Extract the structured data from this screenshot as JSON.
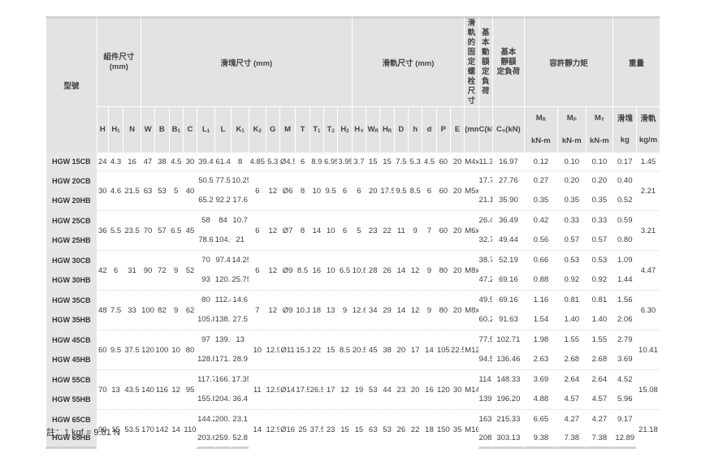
{
  "header": {
    "model": "型號",
    "assembly": "組件尺寸\n(mm)",
    "block": "滑塊尺寸 (mm)",
    "rail": "滑軌尺寸 (mm)",
    "bolt": "滑軌的\n固定螺\n栓尺寸",
    "dyn": "基本\n動額\n定負荷",
    "stat": "基本\n靜額\n定負荷",
    "moment": "容許靜力矩",
    "weight": "重量",
    "block_w": "滑塊",
    "rail_w": "滑軌",
    "bolt_unit": "(mm)",
    "c_unit": "C(kN)",
    "c0_unit": "C₀(kN)",
    "mr_unit": "kN-m",
    "mp_unit": "kN-m",
    "my_unit": "kN-m",
    "kg_unit": "kg",
    "kgm_unit": "kg/m",
    "cols": [
      "H",
      "H₁",
      "N",
      "W",
      "B",
      "B₁",
      "C",
      "L₁",
      "L",
      "K₁",
      "K₂",
      "G",
      "M",
      "T",
      "T₁",
      "T₂",
      "H₂",
      "H₃",
      "W_R",
      "H_R",
      "D",
      "h",
      "d",
      "P",
      "E"
    ],
    "mcols": [
      "M_R",
      "M_P",
      "M_Y"
    ]
  },
  "rows": [
    {
      "model": "HGW 15CB",
      "H": "24",
      "H1": "4.3",
      "N": "16",
      "W": "47",
      "B": "38",
      "B1": "4.5",
      "C": "30",
      "L1": "39.4",
      "L": "61.4",
      "K1": "8",
      "K2": "4.85",
      "G": "5.3",
      "M": "Ø4.5",
      "T": "6",
      "T1": "8.9",
      "T2": "6.95",
      "H2": "3.95",
      "H3": "3.7",
      "WR": "15",
      "HR": "15",
      "D": "7.5",
      "h": "5.3",
      "d": "4.5",
      "P": "60",
      "E": "20",
      "bolt": "M4x16",
      "C_kN": "11.38",
      "C0_kN": "16.97",
      "MR": "0.12",
      "MP": "0.10",
      "MY": "0.10",
      "kg": "0.17",
      "kgm": "1.45"
    },
    {
      "model": "HGW 20CB",
      "H": "30",
      "H1": "4.6",
      "N": "21.5",
      "W": "63",
      "B": "53",
      "B1": "5",
      "C": "40",
      "L1": "50.5",
      "L": "77.5",
      "K1": "10.25",
      "K2": "6",
      "G": "12",
      "M": "Ø6",
      "T": "8",
      "T1": "10",
      "T2": "9.5",
      "H2": "6",
      "H3": "6",
      "WR": "20",
      "HR": "17.5",
      "D": "9.5",
      "h": "8.5",
      "d": "6",
      "P": "60",
      "E": "20",
      "bolt": "M5x16",
      "C_kN": "17.75",
      "C0_kN": "27.76",
      "MR": "0.27",
      "MP": "0.20",
      "MY": "0.20",
      "kg": "0.40",
      "kgm": "2.21"
    },
    {
      "model": "HGW 20HB",
      "L1": "65.2",
      "L": "92.2",
      "K1": "17.6",
      "C_kN": "21.18",
      "C0_kN": "35.90",
      "MR": "0.35",
      "MP": "0.35",
      "MY": "0.35",
      "kg": "0.52"
    },
    {
      "model": "HGW 25CB",
      "H": "36",
      "H1": "5.5",
      "N": "23.5",
      "W": "70",
      "B": "57",
      "B1": "6.5",
      "C": "45",
      "L1": "58",
      "L": "84",
      "K1": "10.7",
      "K2": "6",
      "G": "12",
      "M": "Ø7",
      "T": "8",
      "T1": "14",
      "T2": "10",
      "H2": "6",
      "H3": "5",
      "WR": "23",
      "HR": "22",
      "D": "11",
      "h": "9",
      "d": "7",
      "P": "60",
      "E": "20",
      "bolt": "M6x20",
      "C_kN": "26.48",
      "C0_kN": "36.49",
      "MR": "0.42",
      "MP": "0.33",
      "MY": "0.33",
      "kg": "0.59",
      "kgm": "3.21"
    },
    {
      "model": "HGW 25HB",
      "L1": "78.6",
      "L": "104.6",
      "K1": "21",
      "C_kN": "32.75",
      "C0_kN": "49.44",
      "MR": "0.56",
      "MP": "0.57",
      "MY": "0.57",
      "kg": "0.80"
    },
    {
      "model": "HGW 30CB",
      "H": "42",
      "H1": "6",
      "N": "31",
      "W": "90",
      "B": "72",
      "B1": "9",
      "C": "52",
      "L1": "70",
      "L": "97.4",
      "K1": "14.25",
      "K2": "6",
      "G": "12",
      "M": "Ø9",
      "T": "8.5",
      "T1": "16",
      "T2": "10",
      "H2": "6.5",
      "H3": "10.8",
      "WR": "28",
      "HR": "26",
      "D": "14",
      "h": "12",
      "d": "9",
      "P": "80",
      "E": "20",
      "bolt": "M8x25",
      "C_kN": "38.74",
      "C0_kN": "52.19",
      "MR": "0.66",
      "MP": "0.53",
      "MY": "0.53",
      "kg": "1.09",
      "kgm": "4.47"
    },
    {
      "model": "HGW 30HB",
      "L1": "93",
      "L": "120.4",
      "K1": "25.75",
      "C_kN": "47.27",
      "C0_kN": "69.16",
      "MR": "0.88",
      "MP": "0.92",
      "MY": "0.92",
      "kg": "1.44"
    },
    {
      "model": "HGW 35CB",
      "H": "48",
      "H1": "7.5",
      "N": "33",
      "W": "100",
      "B": "82",
      "B1": "9",
      "C": "62",
      "L1": "80",
      "L": "112.4",
      "K1": "14.6",
      "K2": "7",
      "G": "12",
      "M": "Ø9",
      "T": "10.1",
      "T1": "18",
      "T2": "13",
      "H2": "9",
      "H3": "12.6",
      "WR": "34",
      "HR": "29",
      "D": "14",
      "h": "12",
      "d": "9",
      "P": "80",
      "E": "20",
      "bolt": "M8x25",
      "C_kN": "49.52",
      "C0_kN": "69.16",
      "MR": "1.16",
      "MP": "0.81",
      "MY": "0.81",
      "kg": "1.56",
      "kgm": "6.30"
    },
    {
      "model": "HGW 35HB",
      "L1": "105.8",
      "L": "138.2",
      "K1": "27.5",
      "C_kN": "60.21",
      "C0_kN": "91.63",
      "MR": "1.54",
      "MP": "1.40",
      "MY": "1.40",
      "kg": "2.06"
    },
    {
      "model": "HGW 45CB",
      "H": "60",
      "H1": "9.5",
      "N": "37.5",
      "W": "120",
      "B": "100",
      "B1": "10",
      "C": "80",
      "L1": "97",
      "L": "139.4",
      "K1": "13",
      "K2": "10",
      "G": "12.9",
      "M": "Ø11",
      "T": "15.1",
      "T1": "22",
      "T2": "15",
      "H2": "8.5",
      "H3": "20.5",
      "WR": "45",
      "HR": "38",
      "D": "20",
      "h": "17",
      "d": "14",
      "P": "105",
      "E": "22.5",
      "bolt": "M12x35",
      "C_kN": "77.57",
      "C0_kN": "102.71",
      "MR": "1.98",
      "MP": "1.55",
      "MY": "1.55",
      "kg": "2.79",
      "kgm": "10.41"
    },
    {
      "model": "HGW 45HB",
      "L1": "128.8",
      "L": "171.2",
      "K1": "28.9",
      "C_kN": "94.54",
      "C0_kN": "136.46",
      "MR": "2.63",
      "MP": "2.68",
      "MY": "2.68",
      "kg": "3.69"
    },
    {
      "model": "HGW 55CB",
      "H": "70",
      "H1": "13",
      "N": "43.5",
      "W": "140",
      "B": "116",
      "B1": "12",
      "C": "95",
      "L1": "117.7",
      "L": "166.7",
      "K1": "17.35",
      "K2": "11",
      "G": "12.9",
      "M": "Ø14",
      "T": "17.5",
      "T1": "26.5",
      "T2": "17",
      "H2": "12",
      "H3": "19",
      "WR": "53",
      "HR": "44",
      "D": "23",
      "h": "20",
      "d": "16",
      "P": "120",
      "E": "30",
      "bolt": "M14x45",
      "C_kN": "114.44",
      "C0_kN": "148.33",
      "MR": "3.69",
      "MP": "2.64",
      "MY": "2.64",
      "kg": "4.52",
      "kgm": "15.08"
    },
    {
      "model": "HGW 55HB",
      "L1": "155.8",
      "L": "204.8",
      "K1": "36.4",
      "C_kN": "139.35",
      "C0_kN": "196.20",
      "MR": "4.88",
      "MP": "4.57",
      "MY": "4.57",
      "kg": "5.96"
    },
    {
      "model": "HGW 65CB",
      "H": "90",
      "H1": "15",
      "N": "53.5",
      "W": "170",
      "B": "142",
      "B1": "14",
      "C": "110",
      "L1": "144.2",
      "L": "200.2",
      "K1": "23.1",
      "K2": "14",
      "G": "12.9",
      "M": "Ø16",
      "T": "25",
      "T1": "37.5",
      "T2": "23",
      "H2": "15",
      "H3": "15",
      "WR": "63",
      "HR": "53",
      "D": "26",
      "h": "22",
      "d": "18",
      "P": "150",
      "E": "35",
      "bolt": "M16x50",
      "C_kN": "163.63",
      "C0_kN": "215.33",
      "MR": "6.65",
      "MP": "4.27",
      "MY": "4.27",
      "kg": "9.17",
      "kgm": "21.18"
    },
    {
      "model": "HGW 65HB",
      "L1": "203.6",
      "L": "259.6",
      "K1": "52.8",
      "C_kN": "208.36",
      "C0_kN": "303.13",
      "MR": "9.38",
      "MP": "7.38",
      "MY": "7.38",
      "kg": "12.89"
    }
  ],
  "footnote": "註：1 kgf = 9.81 N"
}
